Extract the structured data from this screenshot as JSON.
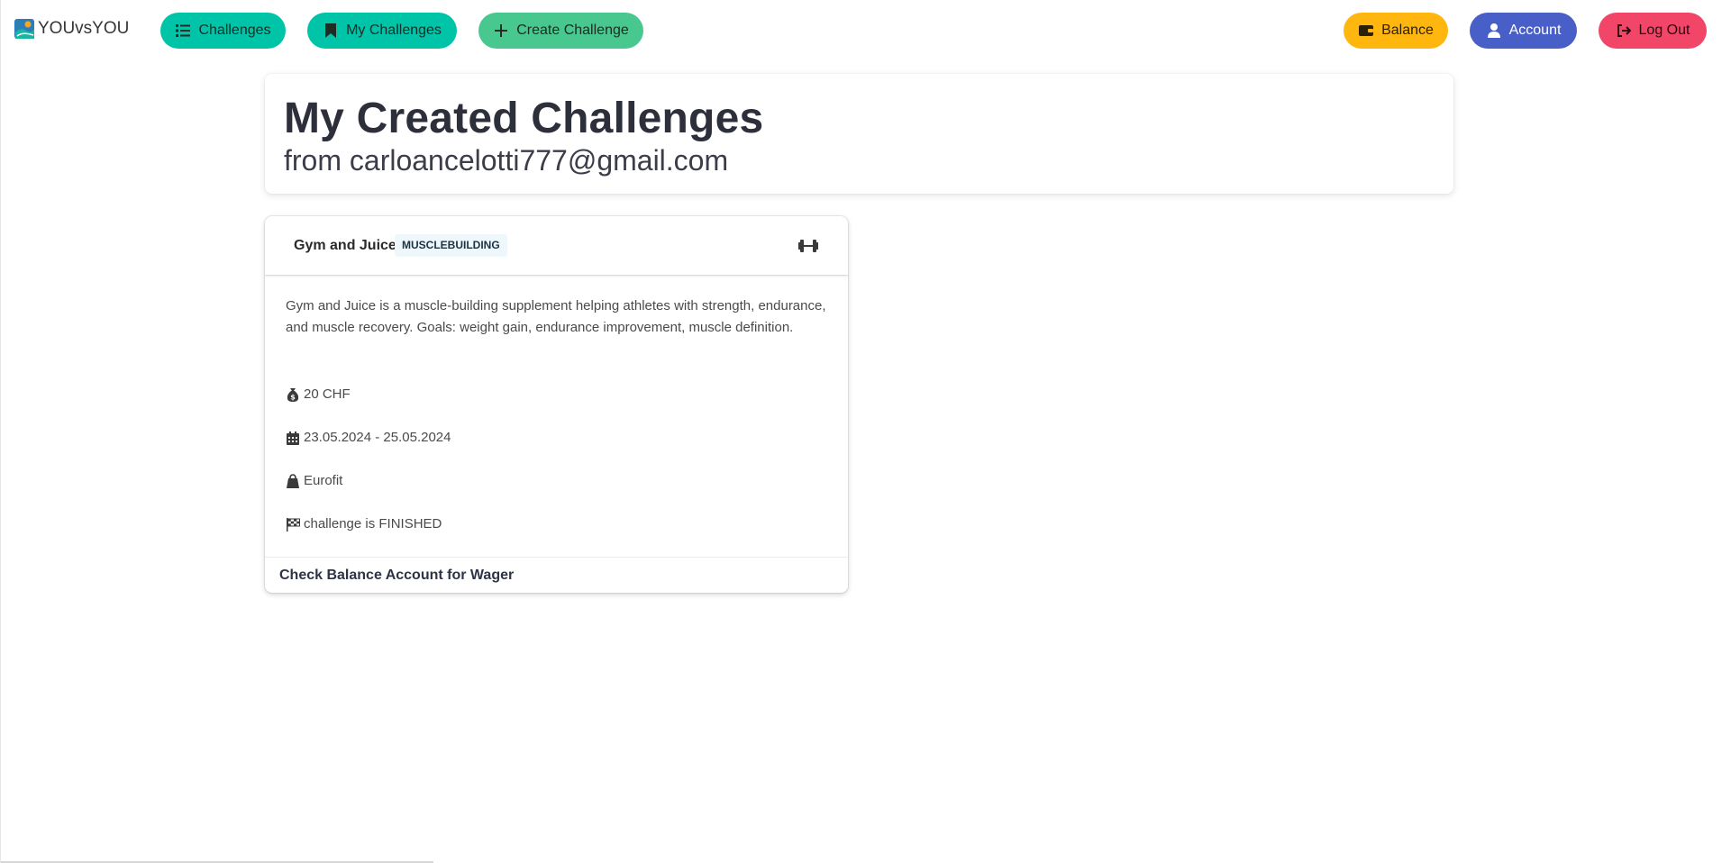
{
  "brand": {
    "name": "YOUvsYOU",
    "logo_icon": "brand-logo-icon"
  },
  "nav": {
    "challenges": {
      "label": "Challenges",
      "icon": "list-icon",
      "color": "#00c4a7"
    },
    "my_challenges": {
      "label": "My Challenges",
      "icon": "bookmark-icon",
      "color": "#00c4a7"
    },
    "create_challenge": {
      "label": "Create Challenge",
      "icon": "plus-icon",
      "color": "#48c78e"
    },
    "balance": {
      "label": "Balance",
      "icon": "wallet-icon",
      "color": "#ffb70f"
    },
    "account": {
      "label": "Account",
      "icon": "user-icon",
      "color": "#485fc7"
    },
    "logout": {
      "label": "Log Out",
      "icon": "sign-out-icon",
      "color": "#f14668"
    }
  },
  "page": {
    "title": "My Created Challenges",
    "subtitle": "from carloancelotti777@gmail.com"
  },
  "challenge": {
    "name": "Gym and Juice",
    "category": "MUSCLEBUILDING",
    "category_icon": "dumbbell-icon",
    "description": "Gym and Juice is a muscle-building supplement helping athletes with strength, endurance, and muscle recovery. Goals: weight gain, endurance improvement, muscle definition.",
    "wager": "20 CHF",
    "dates": "23.05.2024 - 25.05.2024",
    "sponsor": "Eurofit",
    "status": "challenge is FINISHED",
    "footer": "Check Balance Account for Wager"
  }
}
